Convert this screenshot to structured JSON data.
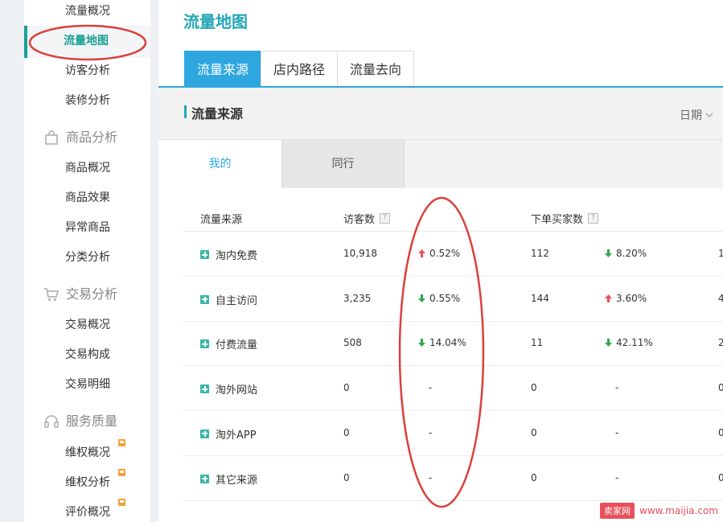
{
  "sidebar": {
    "items": [
      {
        "label": "流量概况"
      },
      {
        "label": "流量地图"
      },
      {
        "label": "访客分析"
      },
      {
        "label": "装修分析"
      }
    ],
    "groups": [
      {
        "title": "商品分析",
        "icon": "bag-icon",
        "items": [
          {
            "label": "商品概况"
          },
          {
            "label": "商品效果"
          },
          {
            "label": "异常商品"
          },
          {
            "label": "分类分析"
          }
        ]
      },
      {
        "title": "交易分析",
        "icon": "cart-icon",
        "items": [
          {
            "label": "交易概况"
          },
          {
            "label": "交易构成"
          },
          {
            "label": "交易明细"
          }
        ]
      },
      {
        "title": "服务质量",
        "icon": "headset-icon",
        "items": [
          {
            "label": "维权概况"
          },
          {
            "label": "维权分析"
          },
          {
            "label": "评价概况"
          }
        ]
      }
    ],
    "active_item": "流量地图",
    "accent_color": "#1aa194"
  },
  "main": {
    "title": "流量地图",
    "tabs": [
      {
        "label": "流量来源",
        "active": true
      },
      {
        "label": "店内路径",
        "active": false
      },
      {
        "label": "流量去向",
        "active": false
      }
    ],
    "section_title": "流量来源",
    "date_filter": "日期",
    "subtabs": [
      {
        "label": "我的",
        "active": true
      },
      {
        "label": "同行",
        "active": false
      }
    ],
    "table": {
      "headers": {
        "source": "流量来源",
        "visitors": "访客数",
        "buyers": "下单买家数",
        "help": "?"
      },
      "rows": [
        {
          "source": "淘内免费",
          "visitors": "10,918",
          "visitors_change": "0.52%",
          "visitors_dir": "up",
          "buyers": "112",
          "buyers_change": "8.20%",
          "buyers_dir": "down",
          "overflow": "1"
        },
        {
          "source": "自主访问",
          "visitors": "3,235",
          "visitors_change": "0.55%",
          "visitors_dir": "down",
          "buyers": "144",
          "buyers_change": "3.60%",
          "buyers_dir": "up",
          "overflow": "4"
        },
        {
          "source": "付费流量",
          "visitors": "508",
          "visitors_change": "14.04%",
          "visitors_dir": "down",
          "buyers": "11",
          "buyers_change": "42.11%",
          "buyers_dir": "down",
          "overflow": "2"
        },
        {
          "source": "淘外网站",
          "visitors": "0",
          "visitors_change": "-",
          "visitors_dir": "none",
          "buyers": "0",
          "buyers_change": "-",
          "buyers_dir": "none",
          "overflow": "0"
        },
        {
          "source": "淘外APP",
          "visitors": "0",
          "visitors_change": "-",
          "visitors_dir": "none",
          "buyers": "0",
          "buyers_change": "-",
          "buyers_dir": "none",
          "overflow": "0"
        },
        {
          "source": "其它来源",
          "visitors": "0",
          "visitors_change": "-",
          "visitors_dir": "none",
          "buyers": "0",
          "buyers_change": "-",
          "buyers_dir": "none",
          "overflow": "0"
        }
      ]
    },
    "colors": {
      "title": "#23a6b8",
      "tab_active": "#2ea7e0",
      "up": "#e8505b",
      "down": "#2fa84f",
      "annotation": "#d9413c"
    }
  },
  "watermark": {
    "logo": "卖家网",
    "url": "www.maijia.com"
  }
}
